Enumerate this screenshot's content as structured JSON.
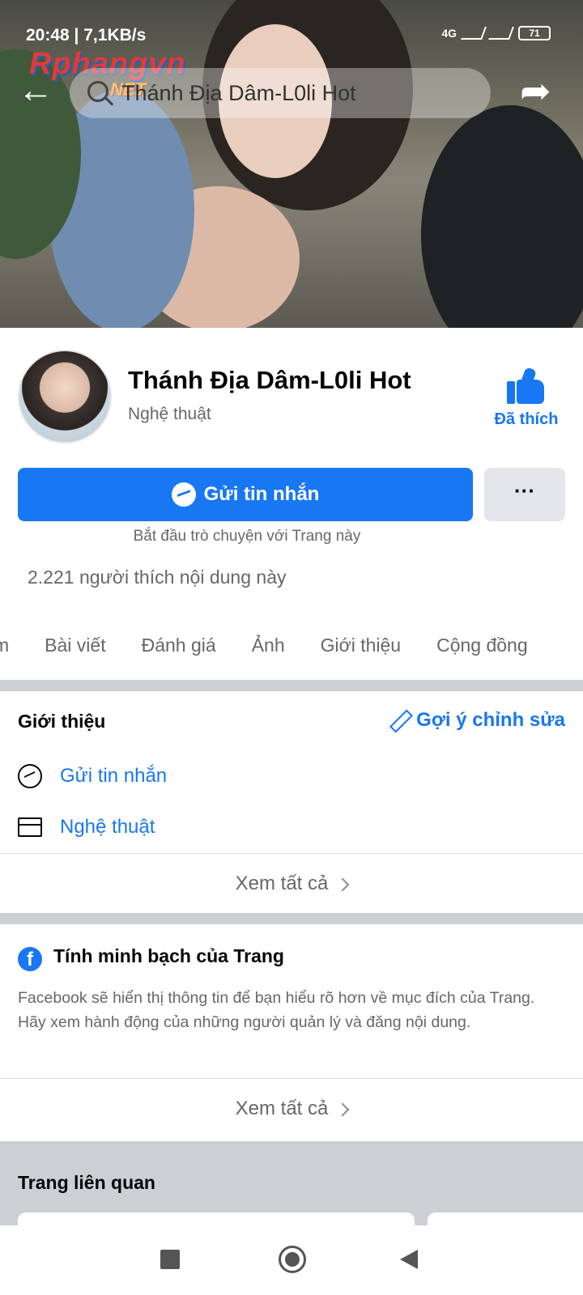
{
  "status_bar": {
    "time_speed": "20:48 | 7,1KB/s",
    "network": "4G",
    "battery": "71"
  },
  "watermark": {
    "line1": "Rphangvn",
    "line2": ".NET"
  },
  "search": {
    "text": "Thánh Địa Dâm-L0li Hot"
  },
  "page": {
    "name": "Thánh Địa Dâm-L0li Hot",
    "category": "Nghệ thuật",
    "liked_label": "Đã thích",
    "message_button": "Gửi tin nhắn",
    "more_button": "···",
    "message_hint": "Bắt đầu trò chuyện với Trang này",
    "likes_text": "2.221 người thích nội dung này"
  },
  "tabs": [
    "m",
    "Bài viết",
    "Đánh giá",
    "Ảnh",
    "Giới thiệu",
    "Cộng đồng"
  ],
  "intro": {
    "title": "Giới thiệu",
    "edit_link": "Gợi ý chỉnh sửa",
    "rows": [
      {
        "icon": "messenger-icon",
        "label": "Gửi tin nhắn"
      },
      {
        "icon": "category-icon",
        "label": "Nghệ thuật"
      }
    ],
    "see_all": "Xem tất cả"
  },
  "transparency": {
    "title": "Tính minh bạch của Trang",
    "description": "Facebook sẽ hiển thị thông tin để bạn hiểu rõ hơn về mục đích của Trang. Hãy xem hành động của những người quản lý và đăng nội dung.",
    "see_all": "Xem tất cả"
  },
  "related": {
    "title": "Trang liên quan"
  },
  "colors": {
    "accent": "#1877f2",
    "secondary_text": "#65676b",
    "divider": "#ccd0d5"
  }
}
